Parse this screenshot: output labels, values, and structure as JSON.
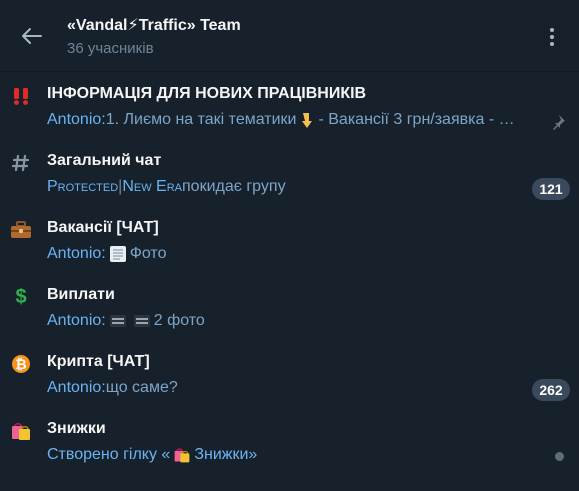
{
  "header": {
    "title": "«Vandal⚡Traffic» Team",
    "subtitle": "36 учасників"
  },
  "topics": [
    {
      "icon": "double-exclamation-icon",
      "title": "ІНФОРМАЦІЯ ДЛЯ НОВИХ ПРАЦІВНИКІВ",
      "sender": "Antonio: ",
      "preview_1": "1. Лиємо на такі тематики",
      "preview_2": " - Вакансії 3 грн/заявка - …",
      "pinned": true
    },
    {
      "icon": "hash-icon",
      "title": "Загальний чат",
      "sender": "Protected",
      "sep": " | ",
      "sender2": "New Era",
      "preview_1": " покидає групу",
      "badge": "121"
    },
    {
      "icon": "briefcase-icon",
      "title": "Вакансії [ЧАТ]",
      "sender": "Antonio: ",
      "preview_1": " Фото"
    },
    {
      "icon": "dollar-icon",
      "title": "Виплати",
      "sender": "Antonio: ",
      "preview_1": " 2 фото"
    },
    {
      "icon": "bitcoin-icon",
      "title": "Крипта [ЧАТ]",
      "sender": "Antonio: ",
      "preview_1": "що саме?",
      "badge": "262"
    },
    {
      "icon": "shopping-bags-icon",
      "title": "Знижки",
      "preview_1": "Створено гілку «",
      "preview_2": " Знижки»",
      "unread_dot": true
    }
  ],
  "colors": {
    "background": "#17212b",
    "accent": "#6ab3f3",
    "muted": "#708499",
    "badge": "#3a4a5c"
  }
}
